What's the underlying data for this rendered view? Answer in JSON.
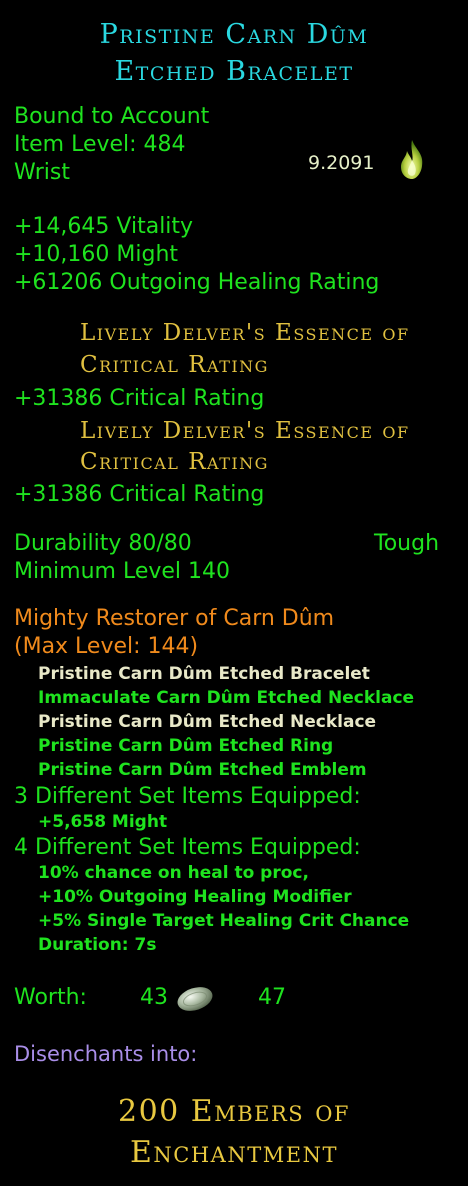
{
  "item": {
    "name_line1": "Pristine Carn Dûm",
    "name_line2": "Etched Bracelet",
    "binding": "Bound to Account",
    "item_level": "Item Level: 484",
    "slot": "Wrist",
    "rating_value": "9.2091",
    "rating_icon": "flame-icon"
  },
  "stats": [
    "+14,645 Vitality",
    "+10,160 Might",
    "+61206 Outgoing Healing Rating"
  ],
  "essences": [
    {
      "name_line1": "Lively Delver's Essence of",
      "name_line2": "Critical Rating",
      "bonus": "+31386 Critical Rating"
    },
    {
      "name_line1": "Lively Delver's Essence of",
      "name_line2": "Critical Rating",
      "bonus": "+31386 Critical Rating"
    }
  ],
  "durability": {
    "label": "Durability 80/80",
    "type": "Tough",
    "min_level": "Minimum Level 140"
  },
  "set": {
    "name": "Mighty Restorer of Carn Dûm",
    "max_level": "(Max Level: 144)",
    "items": [
      {
        "name": "Pristine Carn Dûm Etched Bracelet",
        "equipped": false
      },
      {
        "name": "Immaculate Carn Dûm Etched Necklace",
        "equipped": true
      },
      {
        "name": "Pristine Carn Dûm Etched Necklace",
        "equipped": false
      },
      {
        "name": "Pristine Carn Dûm Etched Ring",
        "equipped": true
      },
      {
        "name": "Pristine Carn Dûm Etched Emblem",
        "equipped": true
      }
    ],
    "bonus3_header": "3 Different Set Items Equipped:",
    "bonus3": [
      "+5,658 Might"
    ],
    "bonus4_header": "4 Different Set Items Equipped:",
    "bonus4": [
      "10% chance on heal to proc,",
      "+10% Outgoing Healing Modifier",
      "+5% Single Target Healing Crit Chance",
      "Duration: 7s"
    ]
  },
  "worth": {
    "label": "Worth:",
    "silver": "43",
    "copper": "47",
    "coin_icon": "silver-coin-icon"
  },
  "disenchant": {
    "label": "Disenchants into:",
    "result_line1": "200 Embers of",
    "result_line2": "Enchantment"
  }
}
